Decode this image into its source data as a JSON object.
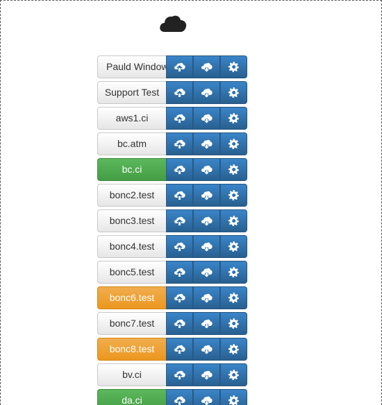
{
  "header": {
    "icon": "cloud-icon"
  },
  "icons": {
    "upload": "cloud-upload-icon",
    "download": "cloud-download-icon",
    "settings": "gear-icon"
  },
  "colors": {
    "default": "#f0f0f0",
    "success": "#5cb85c",
    "warning": "#f0ad4e",
    "primary": "#337ab7"
  },
  "servers": [
    {
      "name": "Pauld Windows",
      "status": "default"
    },
    {
      "name": "Support Test",
      "status": "default"
    },
    {
      "name": "aws1.ci",
      "status": "default"
    },
    {
      "name": "bc.atm",
      "status": "default"
    },
    {
      "name": "bc.ci",
      "status": "success"
    },
    {
      "name": "bonc2.test",
      "status": "default"
    },
    {
      "name": "bonc3.test",
      "status": "default"
    },
    {
      "name": "bonc4.test",
      "status": "default"
    },
    {
      "name": "bonc5.test",
      "status": "default"
    },
    {
      "name": "bonc6.test",
      "status": "warning"
    },
    {
      "name": "bonc7.test",
      "status": "default"
    },
    {
      "name": "bonc8.test",
      "status": "warning"
    },
    {
      "name": "bv.ci",
      "status": "default"
    },
    {
      "name": "da.ci",
      "status": "success"
    }
  ]
}
